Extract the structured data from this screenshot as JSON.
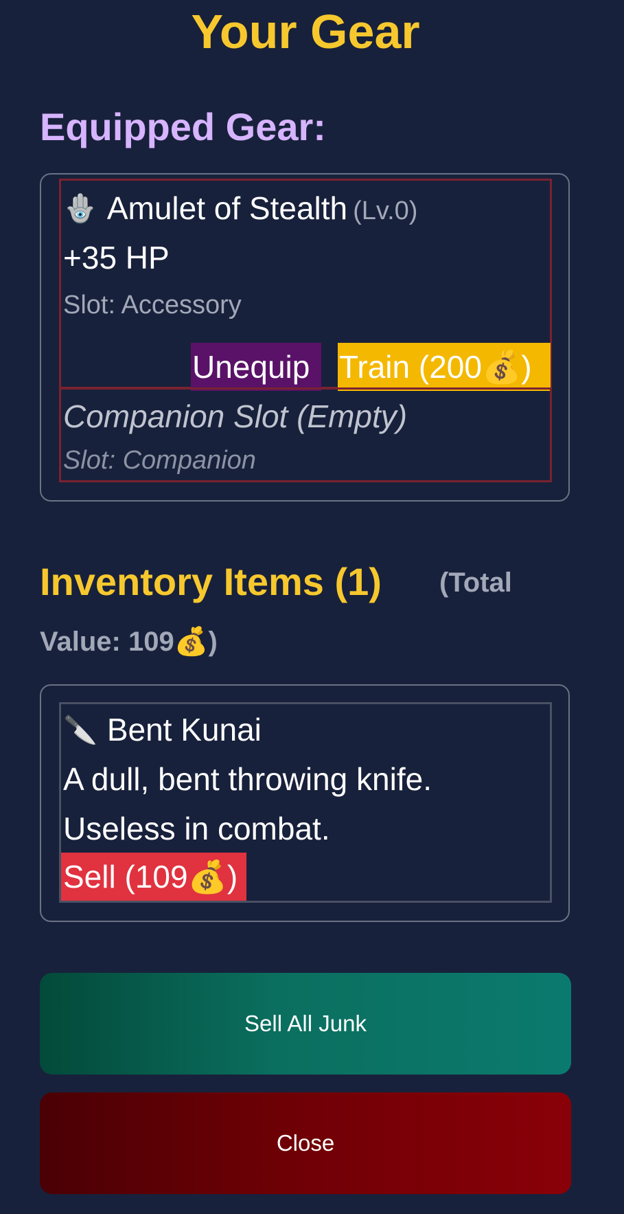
{
  "title": "Your Gear",
  "equipped": {
    "heading": "Equipped Gear:",
    "items": [
      {
        "icon": "hamsa-icon",
        "icon_glyph": "🪬",
        "name": "Amulet of Stealth",
        "level": "(Lv.0)",
        "stat": "+35 HP",
        "slot": "Slot: Accessory",
        "unequip_label": "Unequip",
        "train_label": "Train (200💰)"
      }
    ],
    "companion": {
      "name": "Companion Slot (Empty)",
      "slot": "Slot: Companion"
    }
  },
  "inventory": {
    "heading": "Inventory Items (1)",
    "total_part1": "(Total",
    "total_part2": "Value: 109💰)",
    "items": [
      {
        "icon": "knife-icon",
        "icon_glyph": "🔪",
        "name": "Bent Kunai",
        "desc_line1": "A dull, bent throwing knife.",
        "desc_line2": "Useless in combat.",
        "sell_label": "Sell (109💰)"
      }
    ]
  },
  "actions": {
    "sell_all_label": "Sell All Junk",
    "close_label": "Close"
  },
  "colors": {
    "background": "#18213b",
    "title": "#f7c82e",
    "equipped_heading": "#d6b4fe",
    "unequip": "#5a1268",
    "train": "#f4b800",
    "sell": "#e0323f"
  }
}
